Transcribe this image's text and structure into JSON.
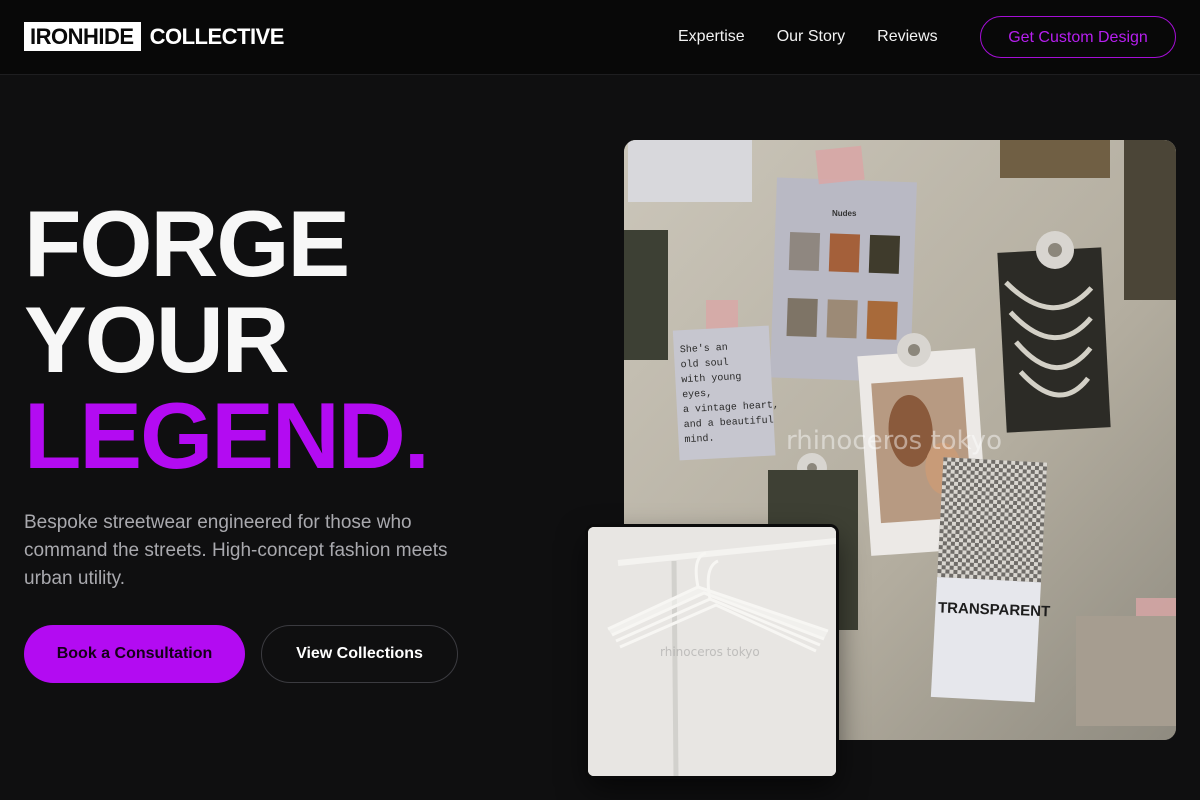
{
  "brand": {
    "logo_box": "IRONHIDE",
    "logo_text": "COLLECTIVE"
  },
  "nav": {
    "links": [
      "Expertise",
      "Our Story",
      "Reviews"
    ],
    "cta": "Get Custom Design"
  },
  "hero": {
    "title_line1": "FORGE",
    "title_line2": "YOUR",
    "title_line3": "LEGEND.",
    "subtitle": "Bespoke streetwear engineered for those who command the streets. High-concept fashion meets urban utility.",
    "primary_button": "Book a Consultation",
    "secondary_button": "View Collections"
  },
  "images": {
    "moodboard_watermark": "rhinoceros tokyo",
    "moodboard_card_title": "TRANSPARENT",
    "moodboard_palette_title": "Nudes",
    "moodboard_note": [
      "She's an",
      "old soul",
      "with young",
      "eyes,",
      "a vintage heart,",
      "and a beautiful",
      "mind."
    ],
    "hanger_watermark": "rhinoceros tokyo"
  },
  "colors": {
    "accent": "#b30bf2",
    "background": "#0f0f10",
    "header": "#080808"
  }
}
